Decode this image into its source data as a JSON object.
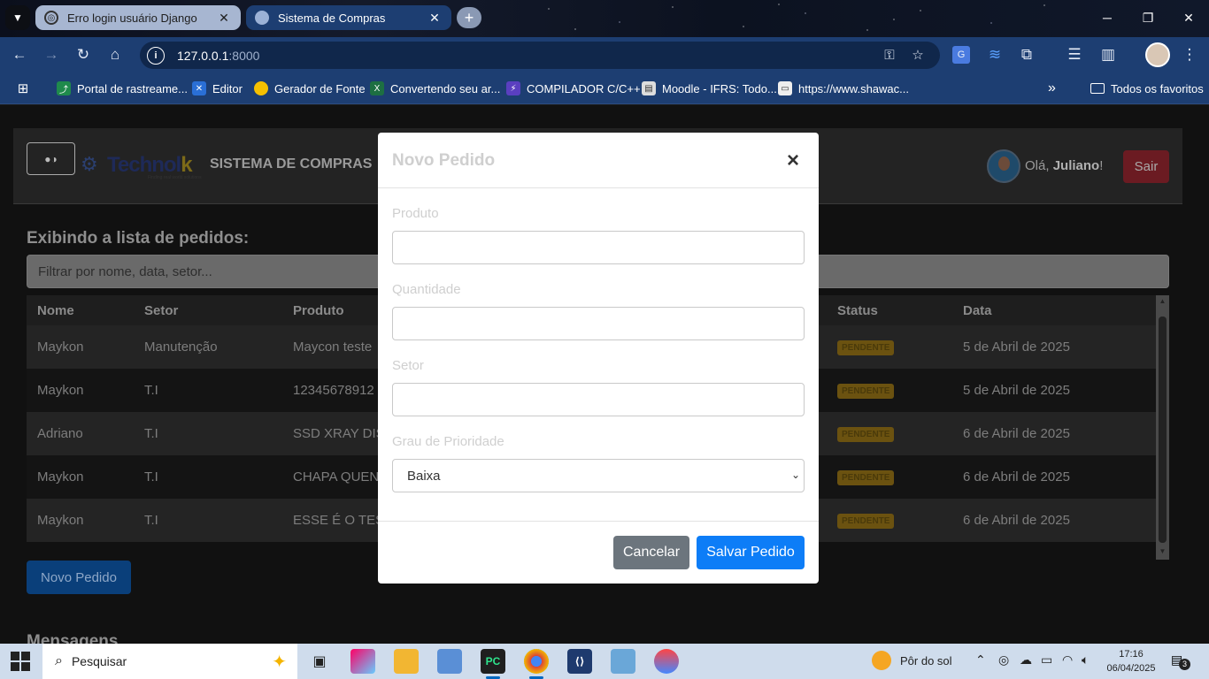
{
  "browser": {
    "tabs": [
      {
        "title": "Erro login usuário Django",
        "active": false
      },
      {
        "title": "Sistema de Compras",
        "active": true
      }
    ],
    "address": {
      "host": "127.0.0.1",
      "port": ":8000"
    },
    "bookmarks": [
      {
        "label": "Portal de rastreame...",
        "icon": "green-link-icon"
      },
      {
        "label": "Editor",
        "icon": "x-blue-icon"
      },
      {
        "label": "Gerador de Fonte",
        "icon": "yellow-circle-icon"
      },
      {
        "label": "Convertendo seu ar...",
        "icon": "excel-icon"
      },
      {
        "label": "COMPILADOR C/C++",
        "icon": "lightning-icon"
      },
      {
        "label": "Moodle - IFRS: Todo...",
        "icon": "moodle-icon"
      },
      {
        "label": "https://www.shawac...",
        "icon": "link-icon"
      }
    ],
    "all_bookmarks_label": "Todos os favoritos"
  },
  "navbar": {
    "brand_main": "Technol",
    "brand_k": "k",
    "brand_tagline": "Finding real world solutions",
    "title": "SISTEMA DE COMPRAS",
    "greeting_prefix": "Olá, ",
    "user_name": "Juliano",
    "greeting_suffix": "!",
    "logout_label": "Sair"
  },
  "orders": {
    "heading": "Exibindo a lista de pedidos:",
    "filter_placeholder": "Filtrar por nome, data, setor...",
    "columns": {
      "name": "Nome",
      "sector": "Setor",
      "product": "Produto",
      "status": "Status",
      "date": "Data"
    },
    "rows": [
      {
        "name": "Maykon",
        "sector": "Manutenção",
        "product": "Maycon teste",
        "status": "PENDENTE",
        "date": "5 de Abril de 2025"
      },
      {
        "name": "Maykon",
        "sector": "T.I",
        "product": "12345678912",
        "status": "PENDENTE",
        "date": "5 de Abril de 2025"
      },
      {
        "name": "Adriano",
        "sector": "T.I",
        "product": "SSD XRAY DIS",
        "status": "PENDENTE",
        "date": "6 de Abril de 2025"
      },
      {
        "name": "Maykon",
        "sector": "T.I",
        "product": "CHAPA QUEN",
        "status": "PENDENTE",
        "date": "6 de Abril de 2025"
      },
      {
        "name": "Maykon",
        "sector": "T.I",
        "product": "ESSE É O TEST",
        "status": "PENDENTE",
        "date": "6 de Abril de 2025"
      }
    ],
    "new_order_label": "Novo Pedido",
    "messages_heading": "Mensagens"
  },
  "modal": {
    "title": "Novo Pedido",
    "close_symbol": "×",
    "fields": {
      "product_label": "Produto",
      "quantity_label": "Quantidade",
      "sector_label": "Setor",
      "priority_label": "Grau de Prioridade",
      "priority_value": "Baixa"
    },
    "cancel_label": "Cancelar",
    "save_label": "Salvar Pedido"
  },
  "taskbar": {
    "search_placeholder": "Pesquisar",
    "weather": "Pôr do sol",
    "time": "17:16",
    "date": "06/04/2025",
    "notification_count": "3"
  },
  "colors": {
    "browser_toolbar": "#1d3e72",
    "save_button": "#0d7df7",
    "cancel_button": "#6c757d",
    "status_pending": "#6b5210"
  }
}
